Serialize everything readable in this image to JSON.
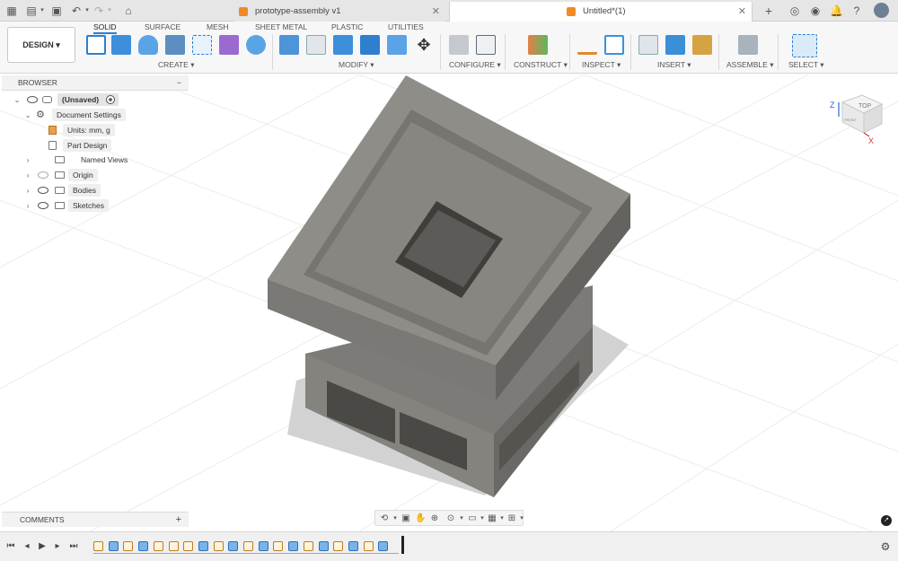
{
  "tabs": [
    {
      "label": "prototype-assembly v1",
      "active": false
    },
    {
      "label": "Untitled*(1)",
      "active": true
    }
  ],
  "workspace_button": "DESIGN",
  "ribbon_tabs": [
    "SOLID",
    "SURFACE",
    "MESH",
    "SHEET METAL",
    "PLASTIC",
    "UTILITIES"
  ],
  "ribbon_groups": [
    "CREATE",
    "MODIFY",
    "CONFIGURE",
    "CONSTRUCT",
    "INSPECT",
    "INSERT",
    "ASSEMBLE",
    "SELECT"
  ],
  "browser": {
    "title": "BROWSER",
    "root": "(Unsaved)",
    "document_settings": "Document Settings",
    "units": "Units: mm, g",
    "part_design": "Part Design",
    "named_views": "Named Views",
    "origin": "Origin",
    "bodies": "Bodies",
    "sketches": "Sketches"
  },
  "comments_label": "COMMENTS",
  "viewcube": {
    "face": "TOP",
    "front": "FRONT",
    "axis_z": "Z",
    "axis_x": "X"
  },
  "timeline_items": [
    "sketch",
    "extrude",
    "sketch",
    "extrude",
    "sketch",
    "sketch",
    "sketch",
    "extrude",
    "sketch",
    "extrude",
    "sketch",
    "extrude",
    "sketch",
    "extrude",
    "sketch",
    "extrude",
    "sketch",
    "extrude",
    "sketch",
    "extrude"
  ],
  "colors": {
    "accent": "#2a7fd4",
    "model_gray": "#8b8a85",
    "viewport_bg": "#ffffff"
  }
}
